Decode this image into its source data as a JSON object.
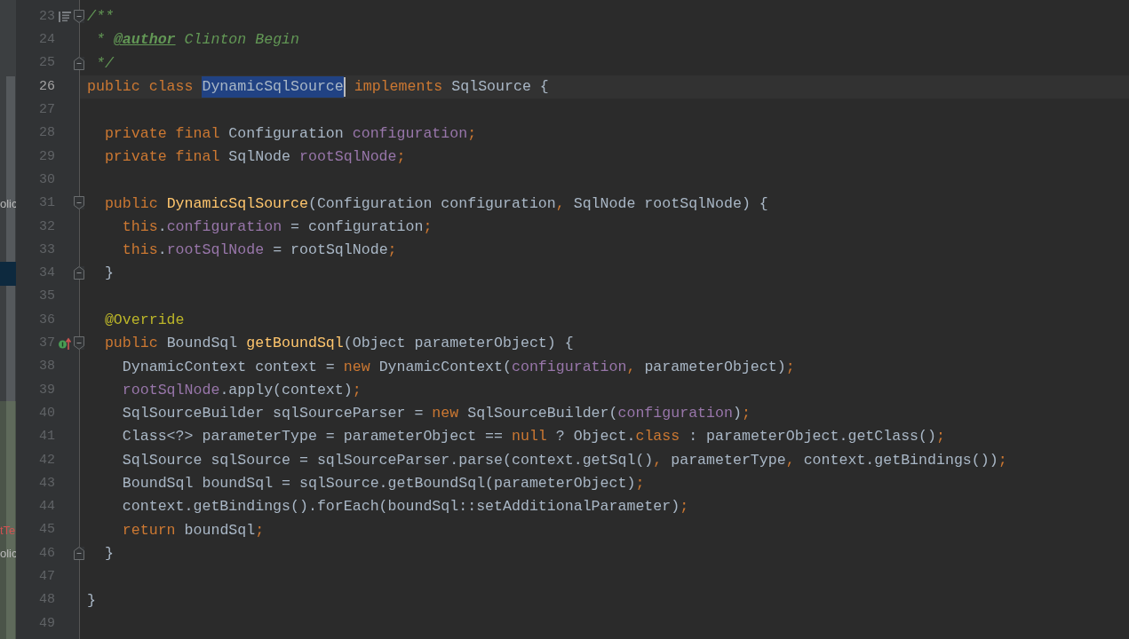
{
  "editor": {
    "lines": [
      {
        "number": "23",
        "doc_marker": true,
        "fold_start": true,
        "tokens": [
          {
            "kind": "comment",
            "text": "/**"
          }
        ]
      },
      {
        "number": "24",
        "tokens": [
          {
            "kind": "comment",
            "text": " * "
          },
          {
            "kind": "doctag",
            "text": "@author"
          },
          {
            "kind": "comment",
            "text": " Clinton Begin"
          }
        ]
      },
      {
        "number": "25",
        "fold_end": true,
        "tokens": [
          {
            "kind": "comment",
            "text": " */"
          }
        ]
      },
      {
        "number": "26",
        "current": true,
        "tokens": [
          {
            "kind": "keyword",
            "text": "public class "
          },
          {
            "kind": "plain",
            "text": "DynamicSqlSource",
            "selected": true,
            "caret": true
          },
          {
            "kind": "keyword",
            "text": " implements "
          },
          {
            "kind": "plain",
            "text": "SqlSource {"
          }
        ]
      },
      {
        "number": "27"
      },
      {
        "number": "28",
        "tokens": [
          {
            "kind": "keyword",
            "text": "  private final "
          },
          {
            "kind": "plain",
            "text": "Configuration "
          },
          {
            "kind": "field",
            "text": "configuration"
          },
          {
            "kind": "keyword",
            "text": ";"
          }
        ]
      },
      {
        "number": "29",
        "tokens": [
          {
            "kind": "keyword",
            "text": "  private final "
          },
          {
            "kind": "plain",
            "text": "SqlNode "
          },
          {
            "kind": "field",
            "text": "rootSqlNode"
          },
          {
            "kind": "keyword",
            "text": ";"
          }
        ]
      },
      {
        "number": "30"
      },
      {
        "number": "31",
        "fold_start": true,
        "side": {
          "kind": "label",
          "text": "olic"
        },
        "tokens": [
          {
            "kind": "keyword",
            "text": "  public "
          },
          {
            "kind": "method",
            "text": "DynamicSqlSource"
          },
          {
            "kind": "plain",
            "text": "(Configuration configuration"
          },
          {
            "kind": "keyword",
            "text": ","
          },
          {
            "kind": "plain",
            "text": " SqlNode rootSqlNode) {"
          }
        ]
      },
      {
        "number": "32",
        "tokens": [
          {
            "kind": "keyword",
            "text": "    this"
          },
          {
            "kind": "plain",
            "text": "."
          },
          {
            "kind": "field",
            "text": "configuration"
          },
          {
            "kind": "plain",
            "text": " = configuration"
          },
          {
            "kind": "keyword",
            "text": ";"
          }
        ]
      },
      {
        "number": "33",
        "tokens": [
          {
            "kind": "keyword",
            "text": "    this"
          },
          {
            "kind": "plain",
            "text": "."
          },
          {
            "kind": "field",
            "text": "rootSqlNode"
          },
          {
            "kind": "plain",
            "text": " = rootSqlNode"
          },
          {
            "kind": "keyword",
            "text": ";"
          }
        ]
      },
      {
        "number": "34",
        "fold_end": true,
        "side": {
          "kind": "selection"
        },
        "tokens": [
          {
            "kind": "plain",
            "text": "  }"
          }
        ]
      },
      {
        "number": "35"
      },
      {
        "number": "36",
        "tokens": [
          {
            "kind": "annotation",
            "text": "  @Override"
          }
        ]
      },
      {
        "number": "37",
        "override_marker": true,
        "fold_start": true,
        "tokens": [
          {
            "kind": "keyword",
            "text": "  public "
          },
          {
            "kind": "plain",
            "text": "BoundSql "
          },
          {
            "kind": "method",
            "text": "getBoundSql"
          },
          {
            "kind": "plain",
            "text": "(Object parameterObject) {"
          }
        ]
      },
      {
        "number": "38",
        "tokens": [
          {
            "kind": "plain",
            "text": "    DynamicContext context = "
          },
          {
            "kind": "keyword",
            "text": "new "
          },
          {
            "kind": "plain",
            "text": "DynamicContext("
          },
          {
            "kind": "field",
            "text": "configuration"
          },
          {
            "kind": "keyword",
            "text": ","
          },
          {
            "kind": "plain",
            "text": " parameterObject)"
          },
          {
            "kind": "keyword",
            "text": ";"
          }
        ]
      },
      {
        "number": "39",
        "tokens": [
          {
            "kind": "field",
            "text": "    rootSqlNode"
          },
          {
            "kind": "plain",
            "text": ".apply(context)"
          },
          {
            "kind": "keyword",
            "text": ";"
          }
        ]
      },
      {
        "number": "40",
        "tokens": [
          {
            "kind": "plain",
            "text": "    SqlSourceBuilder sqlSourceParser = "
          },
          {
            "kind": "keyword",
            "text": "new "
          },
          {
            "kind": "plain",
            "text": "SqlSourceBuilder("
          },
          {
            "kind": "field",
            "text": "configuration"
          },
          {
            "kind": "plain",
            "text": ")"
          },
          {
            "kind": "keyword",
            "text": ";"
          }
        ]
      },
      {
        "number": "41",
        "tokens": [
          {
            "kind": "plain",
            "text": "    Class<?> parameterType = parameterObject == "
          },
          {
            "kind": "keyword",
            "text": "null"
          },
          {
            "kind": "plain",
            "text": " ? Object."
          },
          {
            "kind": "keyword",
            "text": "class"
          },
          {
            "kind": "plain",
            "text": " : parameterObject.getClass()"
          },
          {
            "kind": "keyword",
            "text": ";"
          }
        ]
      },
      {
        "number": "42",
        "tokens": [
          {
            "kind": "plain",
            "text": "    SqlSource sqlSource = sqlSourceParser.parse(context.getSql()"
          },
          {
            "kind": "keyword",
            "text": ","
          },
          {
            "kind": "plain",
            "text": " parameterType"
          },
          {
            "kind": "keyword",
            "text": ","
          },
          {
            "kind": "plain",
            "text": " context.getBindings())"
          },
          {
            "kind": "keyword",
            "text": ";"
          }
        ]
      },
      {
        "number": "43",
        "tokens": [
          {
            "kind": "plain",
            "text": "    BoundSql boundSql = sqlSource.getBoundSql(parameterObject)"
          },
          {
            "kind": "keyword",
            "text": ";"
          }
        ]
      },
      {
        "number": "44",
        "tokens": [
          {
            "kind": "plain",
            "text": "    context.getBindings().forEach(boundSql::setAdditionalParameter)"
          },
          {
            "kind": "keyword",
            "text": ";"
          }
        ]
      },
      {
        "number": "45",
        "side": {
          "kind": "error",
          "text": "tTe"
        },
        "tokens": [
          {
            "kind": "keyword",
            "text": "    return "
          },
          {
            "kind": "plain",
            "text": "boundSql"
          },
          {
            "kind": "keyword",
            "text": ";"
          }
        ]
      },
      {
        "number": "46",
        "fold_end": true,
        "side": {
          "kind": "label",
          "text": "olic"
        },
        "tokens": [
          {
            "kind": "plain",
            "text": "  }"
          }
        ]
      },
      {
        "number": "47"
      },
      {
        "number": "48",
        "tokens": [
          {
            "kind": "plain",
            "text": "}"
          }
        ]
      },
      {
        "number": "49"
      }
    ]
  }
}
